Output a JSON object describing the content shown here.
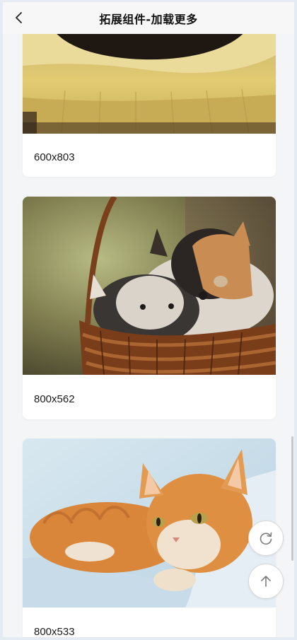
{
  "header": {
    "title": "拓展组件-加载更多"
  },
  "cards": [
    {
      "caption": "600x803"
    },
    {
      "caption": "800x562"
    },
    {
      "caption": "800x533"
    }
  ],
  "icons": {
    "back": "chevron-left-icon",
    "refresh": "refresh-icon",
    "top": "arrow-up-icon"
  }
}
